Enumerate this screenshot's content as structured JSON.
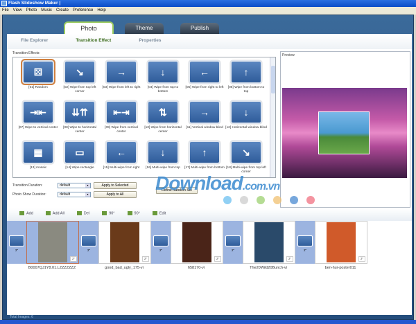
{
  "window": {
    "title": "Flash Slideshow Maker |"
  },
  "menu": [
    "File",
    "View",
    "Photo",
    "Music",
    "Create",
    "Preference",
    "Help"
  ],
  "tabs": [
    {
      "label": "Photo",
      "active": true
    },
    {
      "label": "Theme"
    },
    {
      "label": "Publish"
    }
  ],
  "subtabs": [
    {
      "label": "File Explorer"
    },
    {
      "label": "Transition Effect",
      "active": true
    },
    {
      "label": "Properties"
    }
  ],
  "transitions": {
    "heading": "Transition Effects:",
    "items": [
      "[01] Random",
      "[02] Wipe from top left corner",
      "[03] Wipe from left to right",
      "[04] Wipe from top to bottom",
      "[05] Wipe from right to left",
      "[06] Wipe from bottom to top",
      "[07] Wipe to vertical center",
      "[08] Wipe to horizontal center",
      "[09] Wipe from vertical center",
      "[10] Wipe from horizontal center",
      "[11] Vertical window blind",
      "[12] Horizontal window blind",
      "[13] mosaic",
      "[14] Wipe rectangle",
      "[15] Multi-wipe from right",
      "[16] Multi-wipe from top",
      "[17] Multi-wipe from bottom",
      "[18] Multi-wipe from top left corner"
    ],
    "glyphs": [
      "⚄",
      "↘",
      "→",
      "↓",
      "←",
      "↑",
      "⇥⇤",
      "⇊⇈",
      "⇤⇥",
      "⇅",
      "→",
      "↓",
      "▦",
      "▭",
      "←",
      "↓",
      "↑",
      "↘"
    ]
  },
  "controls": {
    "transition_duration_label": "Transition Duration:",
    "transition_duration_value": "default",
    "photo_duration_label": "Photo Show Duration:",
    "photo_duration_value": "default",
    "apply_selected": "Apply to Selected",
    "apply_all": "Apply to All",
    "define_random": "Define Random Set"
  },
  "preview": {
    "label": "Preview"
  },
  "toolbar": [
    "Add",
    "Add All",
    "Del",
    "90°",
    "90°",
    "Edit"
  ],
  "photos": [
    {
      "name": "B0007QJ1Y8.01.LZZZZZZZ",
      "duration": "2\"",
      "color": "#8a8a80"
    },
    {
      "name": "good_bad_ugly_175-vi",
      "duration": "2\"",
      "color": "#6a3a1a"
    },
    {
      "name": "658170-vi",
      "duration": "2\"",
      "color": "#4a2418"
    },
    {
      "name": "The20Wild20Bunch-vi",
      "duration": "2\"",
      "color": "#2a4a6a"
    },
    {
      "name": "ben-hur-poster011",
      "duration": "2\"",
      "color": "#d05a2a"
    }
  ],
  "transition_duration": "2\"",
  "status": "Total Images: 6",
  "watermark": "Download.com.vn"
}
